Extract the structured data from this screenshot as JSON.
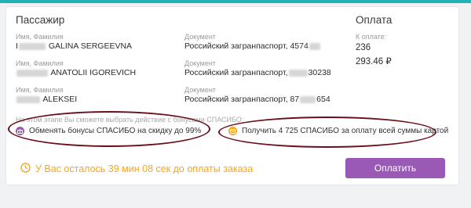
{
  "header": {
    "passenger_title": "Пассажир",
    "payment_title": "Оплата"
  },
  "labels": {
    "name": "Имя, Фамилия",
    "document": "Документ",
    "to_pay": "К оплате:"
  },
  "passengers": [
    {
      "name_prefix": "I",
      "name": "GALINA SERGEEVNA",
      "document_prefix": "Российский загранпаспорт, 4574",
      "document_suffix": ""
    },
    {
      "name_prefix": "",
      "name": "ANATOLII IGOREVICH",
      "document_prefix": "Российский загранпаспорт,",
      "document_suffix": "30238"
    },
    {
      "name_prefix": "",
      "name": "ALEKSEI",
      "document_prefix": "Российский загранпаспорт, 87",
      "document_suffix": "654"
    }
  ],
  "payment": {
    "amount_line1": "236",
    "amount_line2": "293.46 ₽"
  },
  "spasibo": {
    "hint": "На этом этапе Вы сможете выбрать действие с бонусами СПАСИБО:",
    "option1": "Обменять бонусы СПАСИБО на скидку до 99%",
    "option2": "Получить 4 725 СПАСИБО за оплату всей суммы картой"
  },
  "timer": {
    "text": "У Вас осталось 39 мин 08 сек до оплаты заказа"
  },
  "actions": {
    "pay_label": "Оплатить"
  },
  "colors": {
    "accent_teal": "#24b2b4",
    "button_purple": "#9b59b6",
    "timer_orange": "#f5a623",
    "annotation_ellipse": "#6a0f1a"
  },
  "icons": {
    "option1": "gift-icon",
    "option2": "card-icon",
    "timer": "clock-icon"
  }
}
